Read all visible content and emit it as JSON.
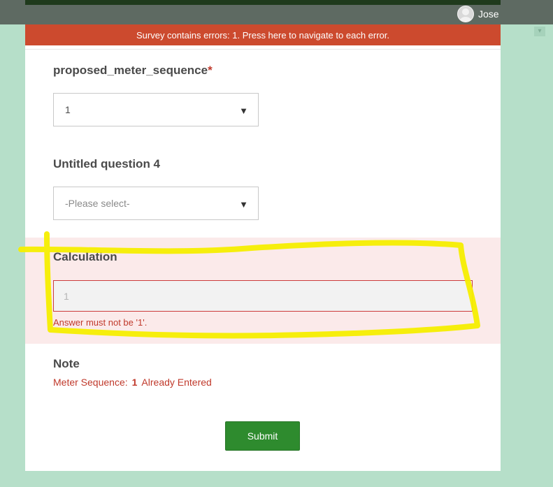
{
  "header": {
    "user_name": "Jose"
  },
  "error_banner": {
    "text": "Survey contains errors: 1. Press here to navigate to each error."
  },
  "questions": {
    "q1": {
      "label": "proposed_meter_sequence",
      "required_marker": "*",
      "value": "1"
    },
    "q2": {
      "label": "Untitled question 4",
      "placeholder": "-Please select-"
    },
    "q3": {
      "label": "Calculation",
      "value": "1",
      "error": "Answer must not be '1'."
    },
    "note": {
      "label": "Note",
      "prefix": "Meter Sequence:",
      "number": "1",
      "suffix": "Already Entered"
    }
  },
  "submit_label": "Submit",
  "colors": {
    "background": "#b6dfc9",
    "error_banner": "#cc4a2e",
    "error_text": "#c0392b",
    "submit": "#2e8b2e",
    "highlight": "#f5ee00"
  }
}
